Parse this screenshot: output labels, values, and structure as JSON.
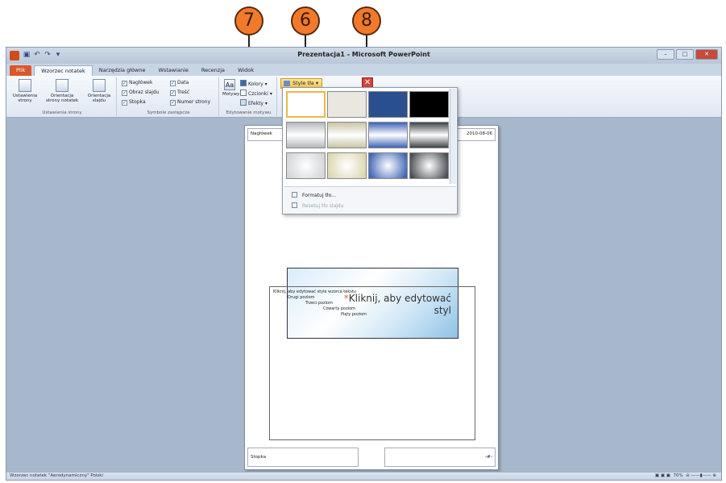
{
  "callouts": [
    "7",
    "6",
    "8"
  ],
  "title_bar": {
    "title": "Prezentacja1 - Microsoft PowerPoint"
  },
  "tabs": [
    "Plik",
    "Wzorzec notatek",
    "Narzędzia główne",
    "Wstawianie",
    "Recenzja",
    "Widok"
  ],
  "ribbon": {
    "page_setup": {
      "setup": "Ustawienia strony",
      "notes_orientation": "Orientacja strony notatek",
      "slide_orientation": "Orientacja slajdu",
      "label": "Ustawienia strony"
    },
    "placeholders": {
      "header": "Nagłówek",
      "slide_image": "Obraz slajdu",
      "footer": "Stopka",
      "date": "Data",
      "body": "Treść",
      "page_number": "Numer strony",
      "label": "Symbole zastępcze"
    },
    "edit_theme": {
      "themes": "Motywy",
      "colors": "Kolory",
      "fonts": "Czcionki",
      "effects": "Efekty",
      "label": "Edytowanie motywu"
    },
    "background_styles": "Style tła"
  },
  "notes_page": {
    "header": "Nagłówek",
    "date": "2010-08-06",
    "slide_title": "Kliknij, aby edytować styl",
    "notes_lines": [
      "Kliknij, aby edytować style wzorca tekstu",
      "Drugi poziom",
      "Trzeci poziom",
      "Czwarty poziom",
      "Piąty poziom"
    ],
    "footer": "Stopka",
    "page_number": "‹#›"
  },
  "gallery": {
    "swatches": [
      "#ffffff",
      "#e9e7df",
      "#2a4f8f",
      "#000000",
      "#b5b8bb",
      "#c9c4a6",
      "#3e64b8",
      "#3f4347",
      "#d2d4d6",
      "#dcd6b0",
      "#3f66b6",
      "#4a4e52"
    ],
    "menu": {
      "format_bg": "Formatuj tło...",
      "reset_bg": "Resetuj tło slajdu"
    }
  },
  "status_bar": {
    "left": "Wzorzec notatek  \"Aerodynamiczny\"  Polski",
    "zoom": "70%"
  }
}
